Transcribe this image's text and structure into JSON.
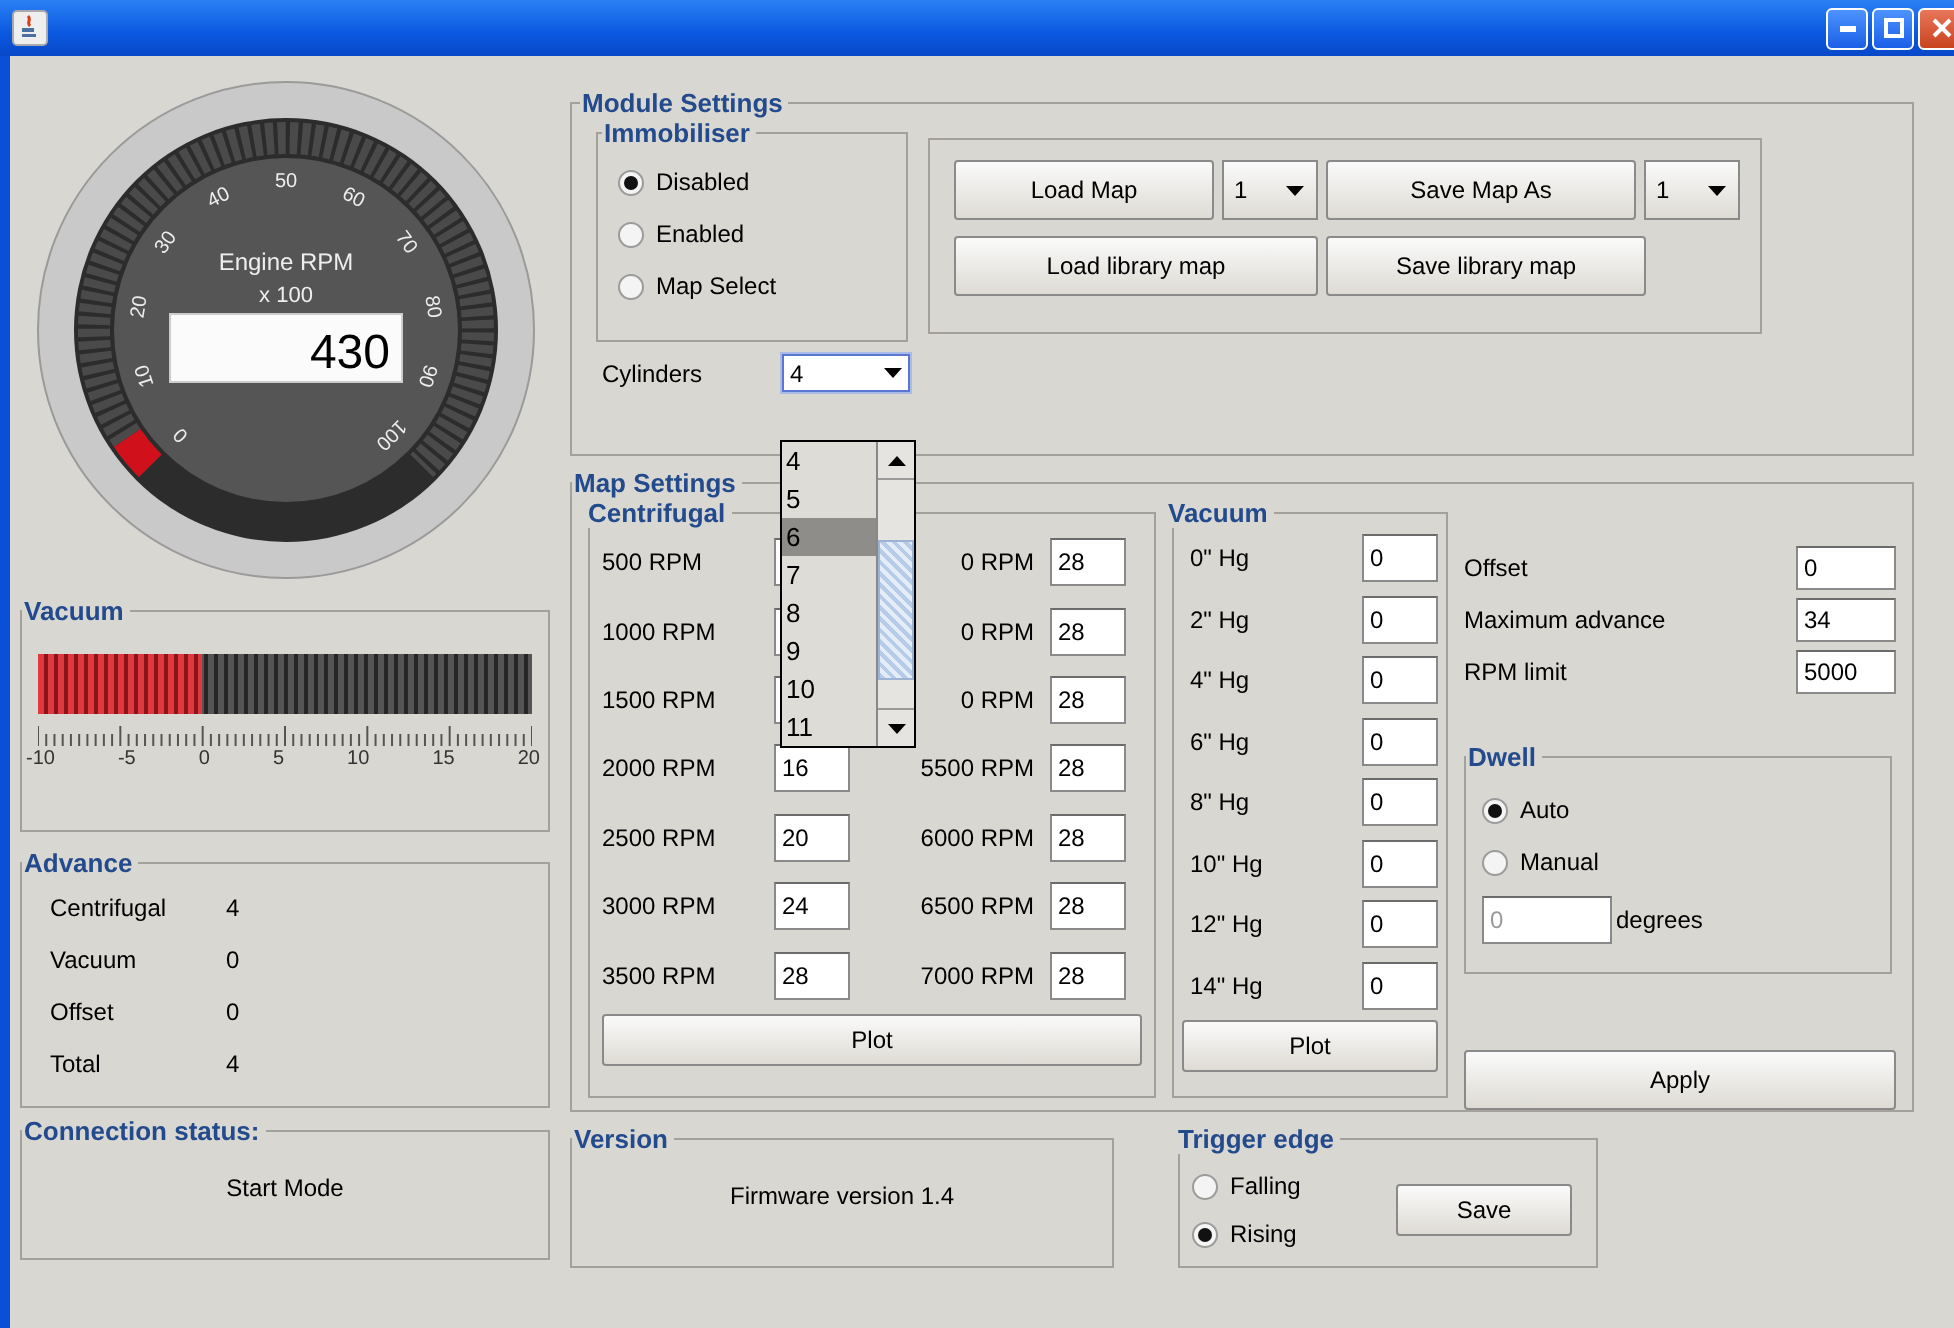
{
  "gauge": {
    "title": "Engine RPM",
    "unit": "x 100",
    "reading": "430",
    "level": 0.04,
    "scale": [
      "0",
      "10",
      "20",
      "30",
      "40",
      "50",
      "60",
      "70",
      "80",
      "90",
      "100"
    ]
  },
  "vacuum_meter": {
    "title": "Vacuum",
    "level": 0.33,
    "scale": [
      "-10",
      "-5",
      "0",
      "5",
      "10",
      "15",
      "20"
    ]
  },
  "advance": {
    "title": "Advance",
    "rows": [
      {
        "label": "Centrifugal",
        "value": "4"
      },
      {
        "label": "Vacuum",
        "value": "0"
      },
      {
        "label": "Offset",
        "value": "0"
      },
      {
        "label": "Total",
        "value": "4"
      }
    ]
  },
  "connection": {
    "title": "Connection status:",
    "text": "Start Mode"
  },
  "module_settings": {
    "title": "Module Settings",
    "immobiliser": {
      "title": "Immobiliser",
      "options": [
        {
          "label": "Disabled",
          "selected": true
        },
        {
          "label": "Enabled",
          "selected": false
        },
        {
          "label": "Map Select",
          "selected": false
        }
      ]
    },
    "map_buttons": {
      "load_map": "Load Map",
      "load_slot": "1",
      "save_map": "Save Map As",
      "save_slot": "1",
      "load_library": "Load library map",
      "save_library": "Save library map"
    },
    "cylinders": {
      "label": "Cylinders",
      "value": "4",
      "expanded": true,
      "options": [
        {
          "label": "4",
          "highlighted": false
        },
        {
          "label": "5",
          "highlighted": false
        },
        {
          "label": "6",
          "highlighted": true
        },
        {
          "label": "7",
          "highlighted": false
        },
        {
          "label": "8",
          "highlighted": false
        },
        {
          "label": "9",
          "highlighted": false
        },
        {
          "label": "10",
          "highlighted": false
        },
        {
          "label": "11",
          "highlighted": false
        }
      ]
    }
  },
  "map_settings": {
    "title": "Map Settings",
    "centrifugal": {
      "title": "Centrifugal",
      "rows": [
        {
          "left_label": "500 RPM",
          "right_label": "0 RPM",
          "right_value": "28"
        },
        {
          "left_label": "1000 RPM",
          "right_label": "0 RPM",
          "right_value": "28"
        },
        {
          "left_label": "1500 RPM",
          "right_label": "0 RPM",
          "right_value": "28"
        },
        {
          "left_label": "2000 RPM",
          "left_value": "16",
          "right_label": "5500 RPM",
          "right_value": "28"
        },
        {
          "left_label": "2500 RPM",
          "left_value": "20",
          "right_label": "6000 RPM",
          "right_value": "28"
        },
        {
          "left_label": "3000 RPM",
          "left_value": "24",
          "right_label": "6500 RPM",
          "right_value": "28"
        },
        {
          "left_label": "3500 RPM",
          "left_value": "28",
          "right_label": "7000 RPM",
          "right_value": "28"
        }
      ],
      "plot": "Plot"
    },
    "vacuum": {
      "title": "Vacuum",
      "rows": [
        {
          "label": "0\" Hg",
          "value": "0"
        },
        {
          "label": "2\" Hg",
          "value": "0"
        },
        {
          "label": "4\" Hg",
          "value": "0"
        },
        {
          "label": "6\" Hg",
          "value": "0"
        },
        {
          "label": "8\" Hg",
          "value": "0"
        },
        {
          "label": "10\" Hg",
          "value": "0"
        },
        {
          "label": "12\" Hg",
          "value": "0"
        },
        {
          "label": "14\" Hg",
          "value": "0"
        }
      ],
      "plot": "Plot"
    },
    "fields": [
      {
        "label": "Offset",
        "value": "0"
      },
      {
        "label": "Maximum advance",
        "value": "34"
      },
      {
        "label": "RPM limit",
        "value": "5000"
      }
    ],
    "dwell": {
      "title": "Dwell",
      "options": [
        {
          "label": "Auto",
          "selected": true
        },
        {
          "label": "Manual",
          "selected": false
        }
      ],
      "degrees_value": "0",
      "degrees_disabled": true,
      "degrees_label": "degrees"
    },
    "apply": "Apply"
  },
  "version": {
    "title": "Version",
    "text": "Firmware version 1.4"
  },
  "trigger_edge": {
    "title": "Trigger edge",
    "options": [
      {
        "label": "Falling",
        "selected": false
      },
      {
        "label": "Rising",
        "selected": true
      }
    ],
    "save": "Save"
  }
}
